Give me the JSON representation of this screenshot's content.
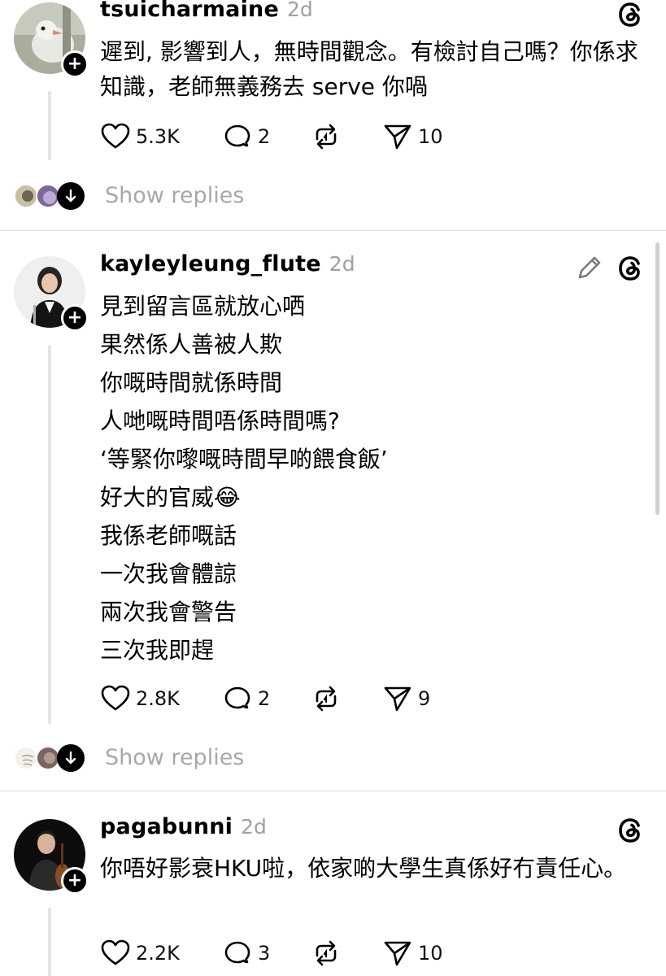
{
  "posts": [
    {
      "username": "tsuicharmaine",
      "time": "2d",
      "text": "遲到, 影響到人，無時間觀念。有檢討自己嗎？你係求知識，老師無義務去 serve 你喎",
      "likes": "5.3K",
      "replies": "2",
      "shares": "10",
      "show_replies": "Show replies"
    },
    {
      "username": "kayleyleung_flute",
      "time": "2d",
      "lines": [
        "見到留言區就放心哂",
        "果然係人善被人欺",
        "你嘅時間就係時間",
        "人哋嘅時間唔係時間嗎?",
        "‘等緊你嚟嘅時間早啲餵食飯’",
        "好大的官威😂",
        "我係老師嘅話",
        "一次我會體諒",
        "兩次我會警告",
        "三次我即趕"
      ],
      "likes": "2.8K",
      "replies": "2",
      "shares": "9",
      "show_replies": "Show replies"
    },
    {
      "username": "pagabunni",
      "time": "2d",
      "text": "你唔好影衰HKU啦，依家啲大學生真係好冇責任心。",
      "likes": "2.2K",
      "replies": "3",
      "shares": "10"
    }
  ],
  "icons": {
    "like": "heart-icon",
    "reply": "comment-icon",
    "repost": "repost-icon",
    "share": "send-icon",
    "threads": "threads-logo-icon",
    "edit": "pencil-icon",
    "follow": "plus-icon",
    "expand": "arrow-down-icon"
  }
}
